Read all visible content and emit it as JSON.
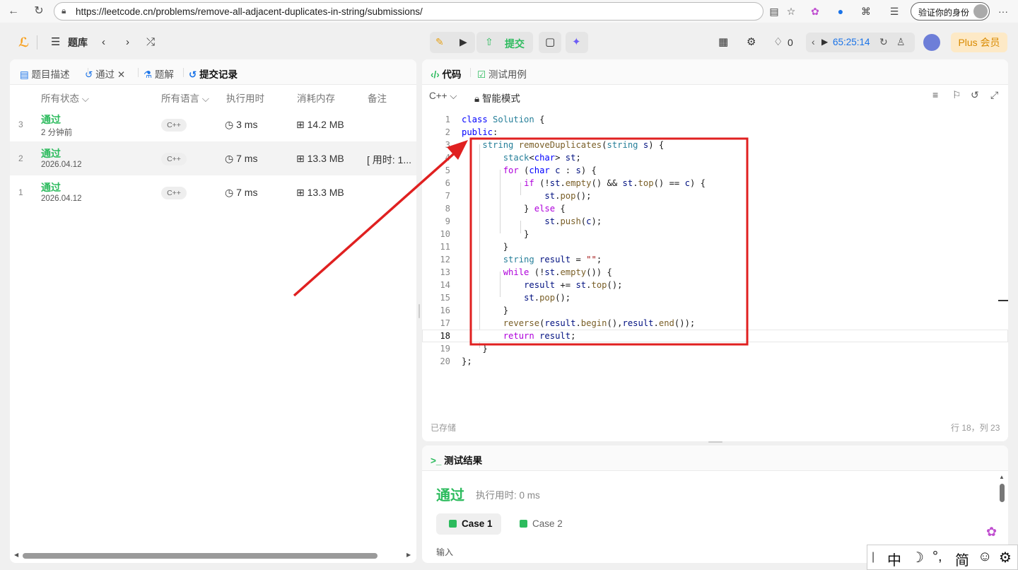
{
  "browser": {
    "url": "https://leetcode.cn/problems/remove-all-adjacent-duplicates-in-string/submissions/",
    "verify_label": "验证你的身份",
    "more": "···"
  },
  "header": {
    "problem_bank": "题库",
    "submit_label": "提交",
    "streak_count": "0",
    "timer": "65:25:14",
    "plus_label": "Plus 会员"
  },
  "left_tabs": [
    "题目描述",
    "通过",
    "题解",
    "提交记录"
  ],
  "columns": [
    "所有状态",
    "所有语言",
    "执行用时",
    "消耗内存",
    "备注"
  ],
  "submissions": [
    {
      "index": "3",
      "status": "通过",
      "time": "2 分钟前",
      "lang": "C++",
      "runtime": "3 ms",
      "memory": "14.2 MB",
      "note": ""
    },
    {
      "index": "2",
      "status": "通过",
      "time": "2026.04.12",
      "lang": "C++",
      "runtime": "7 ms",
      "memory": "13.3 MB",
      "note": "[ 用时: 1..."
    },
    {
      "index": "1",
      "status": "通过",
      "time": "2026.04.12",
      "lang": "C++",
      "runtime": "7 ms",
      "memory": "13.3 MB",
      "note": ""
    }
  ],
  "code_tabs": [
    "代码",
    "测试用例"
  ],
  "editor": {
    "language": "C++",
    "mode": "智能模式",
    "saved": "已存储",
    "cursor": "行 18，列 23"
  },
  "code_lines": [
    "class Solution {",
    "public:",
    "    string removeDuplicates(string s) {",
    "        stack<char> st;",
    "        for (char c : s) {",
    "            if (!st.empty() && st.top() == c) {",
    "                st.pop();",
    "            } else {",
    "                st.push(c);",
    "            }",
    "        }",
    "        string result = \"\";",
    "        while (!st.empty()) {",
    "            result += st.top();",
    "            st.pop();",
    "        }",
    "        reverse(result.begin(),result.end());",
    "        return result;",
    "    }",
    "};"
  ],
  "result": {
    "title": "测试结果",
    "status": "通过",
    "runtime": "执行用时: 0 ms",
    "cases": [
      "Case 1",
      "Case 2"
    ],
    "input_label": "输入"
  },
  "ime": {
    "cursor": "|",
    "lang": "中",
    "moon": "☽",
    "punct": "°,",
    "simplified": "简",
    "emoji": "☺",
    "settings": "⚙"
  },
  "colors": {
    "accent_green": "#2cbb5d",
    "annotation_red": "#e02020",
    "plus_orange": "#d98a00"
  }
}
